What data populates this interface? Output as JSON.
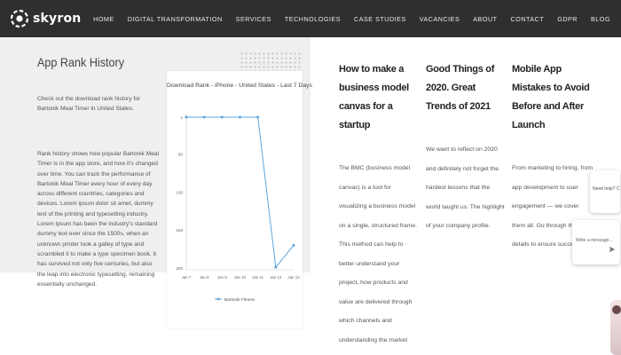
{
  "brand": {
    "name": "skyron"
  },
  "nav": {
    "items": [
      "HOME",
      "DIGITAL TRANSFORMATION",
      "SERVICES",
      "TECHNOLOGIES",
      "CASE STUDIES",
      "VACANCIES",
      "ABOUT",
      "CONTACT",
      "GDPR",
      "BLOG"
    ]
  },
  "page": {
    "title": "App Rank History",
    "intro": "Check out the download rank history for Bartonik Meal Timer in United States.",
    "body": "Rank history shows how popular Bartonik Meal Timer is in the app store, and how it's changed over time. You can track the performance of Bartonik Meal Timer every hour of every day across different countries, categories and devices. Lorem ipsum dolor sit amet, dummy text of the printing and typesetting industry. Lorem Ipsum has been the industry's standard dummy text ever since the 1500s, when an unknown printer took a galley of type and scrambled it to make a type specimen book. It has survived not only five centuries, but also the leap into electronic typesetting, remaining essentially unchanged."
  },
  "chart_data": {
    "type": "line",
    "title": "Download Rank - iPhone - United States - Last 7 Days",
    "x": [
      "Jan 7",
      "Jan 8",
      "Jan 9",
      "Jan 10",
      "Jan 11",
      "Jan 12",
      "Jan 13"
    ],
    "series": [
      {
        "name": "Bartonik Fitness",
        "values": [
          1,
          1,
          1,
          1,
          1,
          199,
          170
        ]
      }
    ],
    "ylim": [
      1,
      200
    ],
    "yticks": [
      1,
      50,
      100,
      150,
      200
    ],
    "ytick_labels": [
      "1",
      "50",
      "100",
      "150",
      "200"
    ],
    "y_inverted": true,
    "color": "#5aa6e0",
    "grid": false,
    "legend": "bottom"
  },
  "articles": [
    {
      "title": "How to make a business model canvas for a startup",
      "excerpt": "The BMC (business model canvas) is a tool for visualizing a business model on a single, structured frame. This method can help to better understand your project, how products and value are delivered through which channels and understanding the market profit."
    },
    {
      "title": "Good Things of 2020. Great Trends of 2021",
      "excerpt": "We want to reflect on 2020 and definitely not forget the hardest lessons that the world taught us. The highlight of your company profile."
    },
    {
      "title": "Mobile App Mistakes to Avoid Before and After Launch",
      "excerpt": "From marketing to hiring, from app development to user engagement — we cover them all. Go through these details to ensure success."
    }
  ],
  "chat": {
    "bubble_text": "Need help? Chat with us",
    "input_placeholder": "Write a message..."
  },
  "colors": {
    "nav_bg": "#2f2f2f",
    "panel_bg": "#efefef",
    "accent": "#5aa6e0"
  }
}
